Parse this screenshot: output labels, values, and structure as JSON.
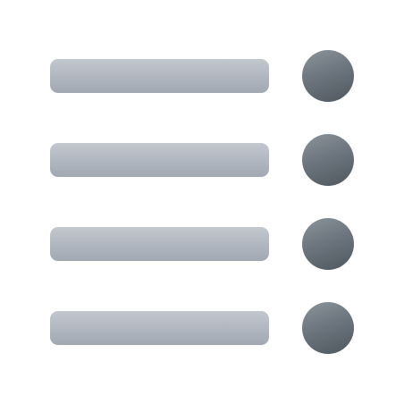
{
  "icon": {
    "name": "list-icon",
    "items": [
      {
        "label": ""
      },
      {
        "label": ""
      },
      {
        "label": ""
      },
      {
        "label": ""
      }
    ],
    "colors": {
      "bar": "#b0b6bf",
      "dot": "#68707a",
      "background": "#ffffff"
    }
  }
}
